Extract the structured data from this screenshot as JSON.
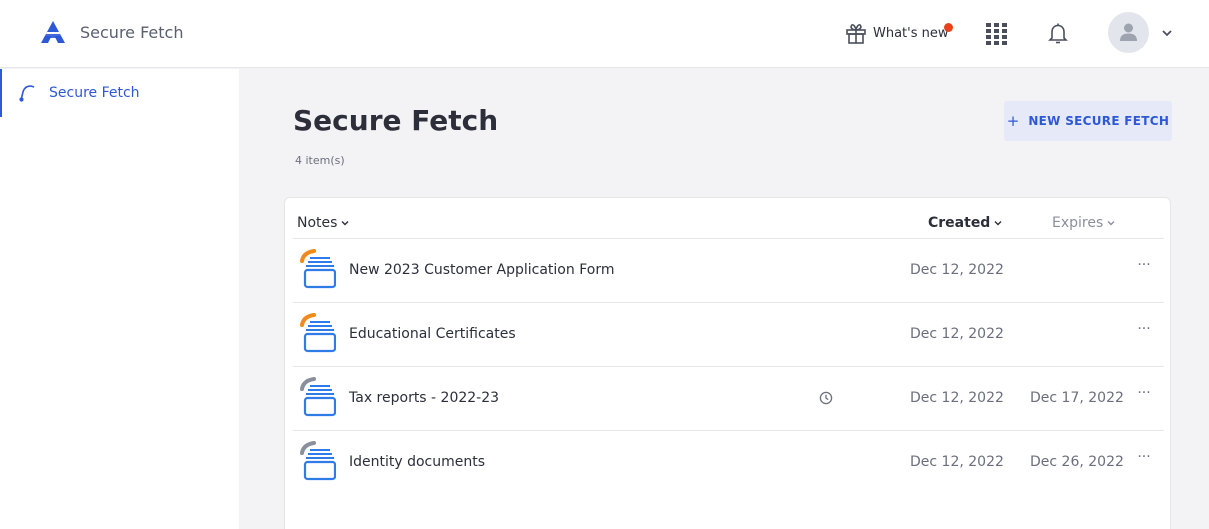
{
  "header": {
    "app_title": "Secure Fetch",
    "whats_new": "What's new",
    "notification_dot_color": "#e8421c"
  },
  "sidebar": {
    "items": [
      {
        "label": "Secure Fetch",
        "icon": "secure-fetch-icon",
        "active": true
      }
    ]
  },
  "main": {
    "title": "Secure Fetch",
    "item_count": "4 item(s)",
    "new_button": {
      "plus": "+",
      "label": "NEW SECURE FETCH"
    }
  },
  "table": {
    "columns": {
      "notes": "Notes",
      "created": "Created",
      "expires": "Expires"
    },
    "rows": [
      {
        "name": "New 2023 Customer Application Form",
        "created": "Dec 12, 2022",
        "expires": "",
        "status_color": "#f08a1c",
        "has_clock": false
      },
      {
        "name": "Educational Certificates",
        "created": "Dec 12, 2022",
        "expires": "",
        "status_color": "#f08a1c",
        "has_clock": false
      },
      {
        "name": "Tax reports - 2022-23",
        "created": "Dec 12, 2022",
        "expires": "Dec 17, 2022",
        "status_color": "#8a8f9c",
        "has_clock": true
      },
      {
        "name": "Identity documents",
        "created": "Dec 12, 2022",
        "expires": "Dec 26, 2022",
        "status_color": "#8a8f9c",
        "has_clock": false
      }
    ],
    "more_glyph": "···"
  },
  "colors": {
    "accent": "#2d58d6",
    "folder_blue": "#2f7be8"
  }
}
